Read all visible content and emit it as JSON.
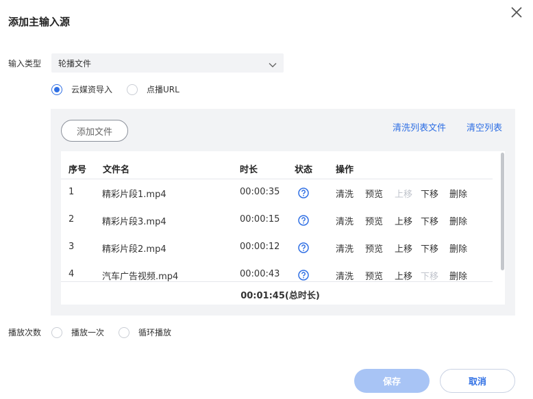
{
  "dialog": {
    "title": "添加主输入源"
  },
  "input_type": {
    "label": "输入类型",
    "selected": "轮播文件"
  },
  "source": {
    "options": [
      {
        "label": "云媒资导入",
        "checked": true
      },
      {
        "label": "点播URL",
        "checked": false
      }
    ]
  },
  "panel": {
    "add_file": "添加文件",
    "clean_list_files": "清洗列表文件",
    "clear_list": "清空列表"
  },
  "table": {
    "headers": [
      "序号",
      "文件名",
      "时长",
      "状态",
      "操作"
    ],
    "actions": [
      "清洗",
      "预览",
      "上移",
      "下移",
      "删除"
    ],
    "rows": [
      {
        "index": "1",
        "file": "精彩片段1.mp4",
        "duration": "00:00:35",
        "status_icon": "help-icon",
        "up_disabled": true,
        "down_disabled": false
      },
      {
        "index": "2",
        "file": "精彩片段3.mp4",
        "duration": "00:00:15",
        "status_icon": "help-icon",
        "up_disabled": false,
        "down_disabled": false
      },
      {
        "index": "3",
        "file": "精彩片段2.mp4",
        "duration": "00:00:12",
        "status_icon": "help-icon",
        "up_disabled": false,
        "down_disabled": false
      },
      {
        "index": "4",
        "file": "汽车广告视频.mp4",
        "duration": "00:00:43",
        "status_icon": "help-icon",
        "up_disabled": false,
        "down_disabled": true
      }
    ],
    "total": "00:01:45(总时长)"
  },
  "play_count": {
    "label": "播放次数",
    "options": [
      {
        "label": "播放一次",
        "checked": false
      },
      {
        "label": "循环播放",
        "checked": false
      }
    ]
  },
  "footer": {
    "save": "保存",
    "cancel": "取消"
  },
  "colors": {
    "accent": "#2f6fe4",
    "save_disabled": "#a8c4f5",
    "panel_bg": "#f2f3f5"
  }
}
